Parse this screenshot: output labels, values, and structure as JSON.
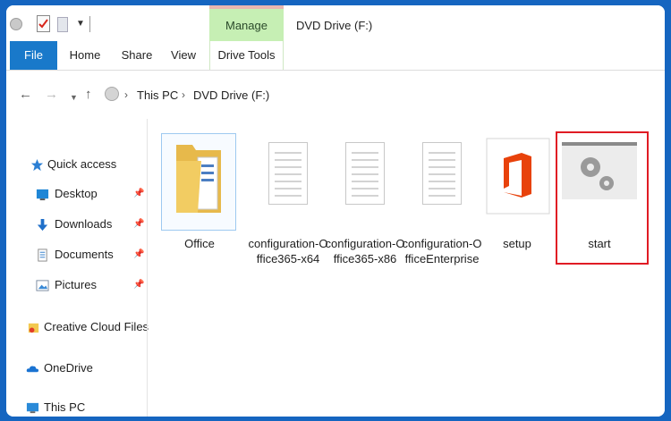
{
  "window": {
    "title": "DVD Drive (F:)",
    "context_tab": "Manage"
  },
  "ribbon": {
    "tabs": [
      "File",
      "Home",
      "Share",
      "View",
      "Drive Tools"
    ]
  },
  "address": {
    "crumbs": [
      "This PC",
      "DVD Drive (F:)"
    ]
  },
  "sidebar": {
    "items": [
      {
        "label": "Quick access",
        "icon": "star-icon",
        "pinned": false
      },
      {
        "label": "Desktop",
        "icon": "desktop-icon",
        "pinned": true
      },
      {
        "label": "Downloads",
        "icon": "download-icon",
        "pinned": true
      },
      {
        "label": "Documents",
        "icon": "documents-icon",
        "pinned": true
      },
      {
        "label": "Pictures",
        "icon": "pictures-icon",
        "pinned": true
      },
      {
        "label": "Creative Cloud Files",
        "icon": "creative-cloud-icon",
        "pinned": false
      },
      {
        "label": "OneDrive",
        "icon": "onedrive-icon",
        "pinned": false
      },
      {
        "label": "This PC",
        "icon": "this-pc-icon",
        "pinned": false
      }
    ]
  },
  "files": [
    {
      "name": "Office",
      "icon": "folder-icon"
    },
    {
      "name": "configuration-Office365-x64",
      "icon": "document-icon"
    },
    {
      "name": "configuration-Office365-x86",
      "icon": "document-icon"
    },
    {
      "name": "configuration-OfficeEnterprise",
      "icon": "document-icon"
    },
    {
      "name": "setup",
      "icon": "office-logo-icon"
    },
    {
      "name": "start",
      "icon": "settings-gears-icon"
    }
  ],
  "colors": {
    "file_tab": "#1979ca",
    "manage_tab": "#c6efb4",
    "highlight": "#e01b24",
    "office_orange": "#e8420b"
  }
}
